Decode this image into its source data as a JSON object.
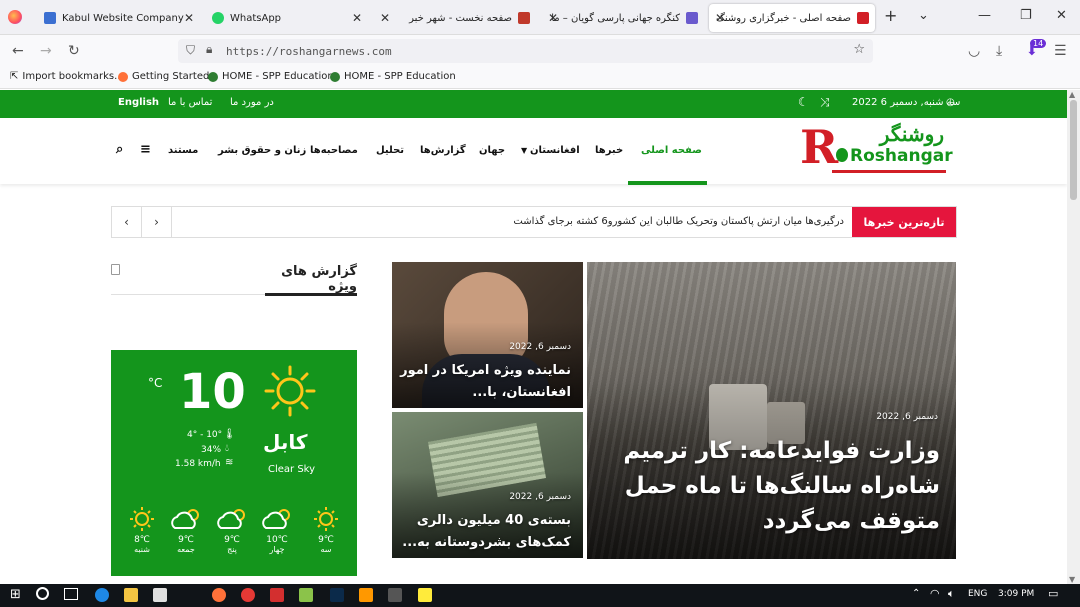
{
  "browser": {
    "tabs": [
      {
        "label": "Kabul Website Company",
        "color": "#3b6fd1"
      },
      {
        "label": "WhatsApp",
        "color": "#25d366"
      },
      {
        "label": "صفحه نخست - شهر خبر",
        "color": "#c0392b"
      },
      {
        "label": "کنگره جهانی پارسی گویان – ما",
        "color": "#6a5acd"
      },
      {
        "label": "صفحه اصلی - خبرگزاری روشنگ",
        "color": "#d21f26"
      }
    ],
    "url": "https://roshangarnews.com",
    "bookmarks": [
      "Import bookmarks...",
      "Getting Started",
      "HOME - SPP Education",
      "HOME - SPP Education"
    ],
    "badge": "14"
  },
  "site": {
    "topbar": {
      "date": "سه شنبه, دسمبر 6 2022",
      "about": "در مورد ما",
      "contact": "تماس با ما",
      "english": "English"
    },
    "logo": {
      "persian": "روشنگر",
      "latin": "Roshangar"
    },
    "menu": [
      "صفحه اصلی",
      "خبرها",
      "افغانستان",
      "جهان",
      "گزارش‌ها",
      "تحلیل",
      "مصاحبه‌ها",
      "زنان و حقوق بشر",
      "مستند"
    ],
    "ticker": {
      "label": "تازه‌ترین خبرها",
      "text": "درگیری‌ها میان ارتش پاکستان وتحریک طالبان این کشورو6 کشته برجای گذاشت"
    },
    "featured": [
      {
        "date": "دسمبر 6, 2022",
        "title": "وزارت فوایدعامه: کار ترمیم شاه‌راه سالنگ‌ها تا ماه حمل متوقف می‌گردد"
      },
      {
        "date": "دسمبر 6, 2022",
        "title": "نماینده ویژه امریکا در امور افغانستان، با..."
      },
      {
        "date": "دسمبر 6, 2022",
        "title": "بسته‌ی 40 میلیون دالری کمک‌های بشردوستانه به..."
      }
    ],
    "sidebar": {
      "heading": "گزارش های ویژه"
    },
    "weather": {
      "temp": "10",
      "unit": "°C",
      "city": "کابل",
      "condition": "Clear Sky",
      "range": "4° - 10°",
      "humidity": "34%",
      "wind": "1.58 km/h",
      "forecast": [
        {
          "day": "سه",
          "temp": "9℃"
        },
        {
          "day": "چهار",
          "temp": "10℃"
        },
        {
          "day": "پنج",
          "temp": "9℃"
        },
        {
          "day": "جمعه",
          "temp": "9℃"
        },
        {
          "day": "شنبه",
          "temp": "8℃"
        }
      ]
    }
  },
  "taskbar": {
    "lang": "ENG",
    "time": "3:09 PM"
  },
  "colors": {
    "green": "#14951c",
    "red": "#e5153d"
  }
}
